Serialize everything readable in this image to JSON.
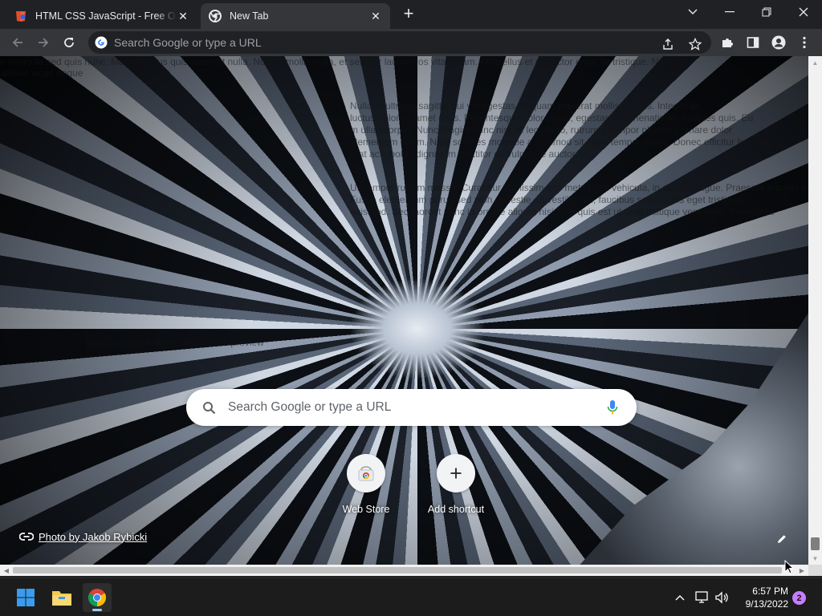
{
  "tabs": [
    {
      "title": "HTML CSS JavaScript - Free Online Editor",
      "active": false
    },
    {
      "title": "New Tab",
      "active": true
    }
  ],
  "omnibox": {
    "placeholder": "Search Google or type a URL"
  },
  "ntp": {
    "search_placeholder": "Search Google or type a URL",
    "shortcuts": [
      {
        "label": "Web Store"
      },
      {
        "label": "Add shortcut"
      }
    ],
    "attribution": "Photo by Jakob Rybicki"
  },
  "background_text": {
    "line1": "n vehicula sed quis nunc. Mauris luctus quis placerat nulla. Nullam mollis nulla, et semper lacus eros vitae diam. Phasellus et ut auctor enim, ut tristique. Nullam",
    "line2": "aliquet lacus neque",
    "para1": [
      "Nulla ut ultrices sagittis dui vel egestas. Aliquam placerat mollis sagittis. Integer ac",
      "luctus dolor sit amet risus. Pellentesque dolor purus, egestas et venenatis ac, sodales quis. Eu",
      "m ullamcorper. Nunc feugiat nunc nisl, in leo libero, rutrum a tempor pharetra ornare dolor",
      "elementum lorem. Nam sodales molestie a euismod sit amet tempor mollis. Donec efficitur hendrerit",
      "erat ac lobortis dignissim porttitor ex vulputate auctor."
    ],
    "para2": [
      "Ut semper rutrum massa. Curabitur dignissim nec metus sed vehicula, in dictum augue. Praesent a turpis velit",
      "Fusce elementum purus sed nibh molestie, ut vestibulum, faucibus sed mauris eget tristique",
      "euismod. Sed laoreet nunc in ornare aliquet nisi, non quis est ut urna tristique venenatis. Proin vitae"
    ],
    "caption": "and JavaScript editor with instant preview"
  },
  "taskbar": {
    "time": "6:57 PM",
    "date": "9/13/2022",
    "notification_count": "2"
  },
  "colors": {
    "accent_blue": "#8ab4f8",
    "mic_blue": "#4285f4",
    "chrome_dark": "#202124"
  }
}
